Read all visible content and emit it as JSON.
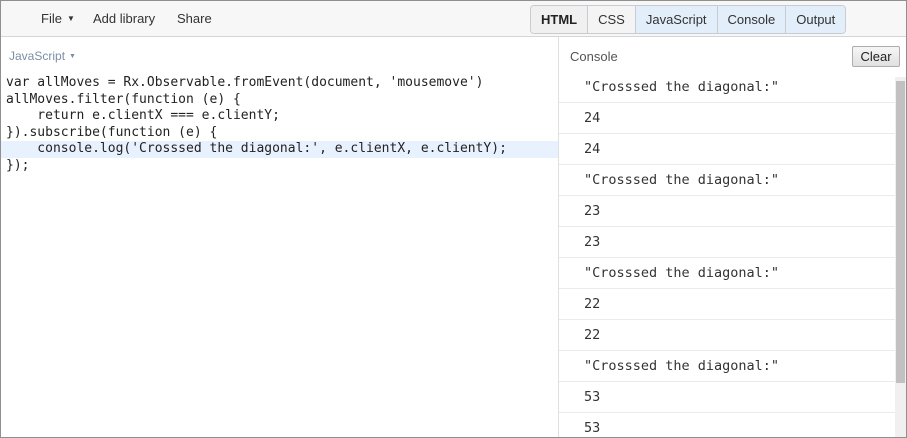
{
  "toolbar": {
    "file_label": "File",
    "add_library_label": "Add library",
    "share_label": "Share",
    "tabs": [
      {
        "label": "HTML"
      },
      {
        "label": "CSS"
      },
      {
        "label": "JavaScript"
      },
      {
        "label": "Console"
      },
      {
        "label": "Output"
      }
    ]
  },
  "editor": {
    "language": "JavaScript",
    "code_lines": [
      "var allMoves = Rx.Observable.fromEvent(document, 'mousemove')",
      "allMoves.filter(function (e) {",
      "    return e.clientX === e.clientY;",
      "}).subscribe(function (e) {",
      "    console.log('Crosssed the diagonal:', e.clientX, e.clientY);",
      "});"
    ]
  },
  "console": {
    "title": "Console",
    "clear_label": "Clear",
    "entries": [
      "\"Crosssed the diagonal:\"",
      "24",
      "24",
      "\"Crosssed the diagonal:\"",
      "23",
      "23",
      "\"Crosssed the diagonal:\"",
      "22",
      "22",
      "\"Crosssed the diagonal:\"",
      "53",
      "53"
    ]
  },
  "colors": {
    "active_tab_bg": "#e2eefa",
    "highlight_line_bg": "#e8f2ff",
    "language_label": "#7c8ea6"
  }
}
